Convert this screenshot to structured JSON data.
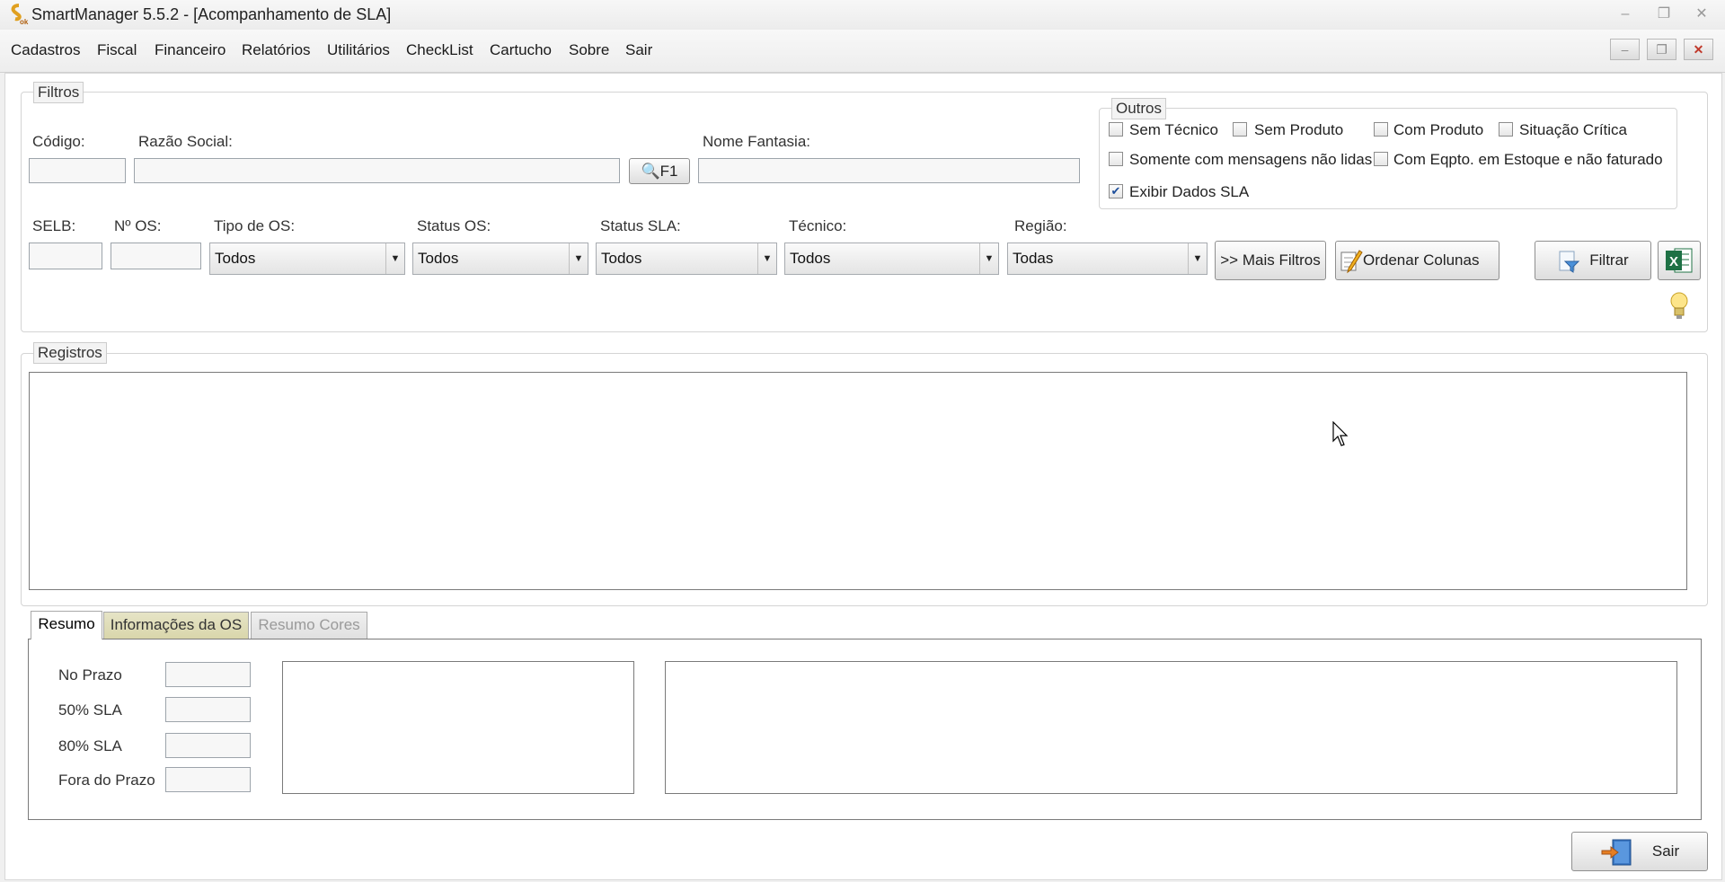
{
  "window": {
    "title": "SmartManager 5.5.2 - [Acompanhamento de SLA]"
  },
  "menu": [
    "Cadastros",
    "Fiscal",
    "Financeiro",
    "Relatórios",
    "Utilitários",
    "CheckList",
    "Cartucho",
    "Sobre",
    "Sair"
  ],
  "filtros": {
    "legend": "Filtros",
    "codigo_label": "Código:",
    "razao_label": "Razão Social:",
    "f1_label": "F1",
    "fantasia_label": "Nome Fantasia:",
    "selb_label": "SELB:",
    "nos_label": "Nº OS:",
    "tipo_os": {
      "label": "Tipo de OS:",
      "value": "Todos"
    },
    "status_os": {
      "label": "Status OS:",
      "value": "Todos"
    },
    "status_sla": {
      "label": "Status SLA:",
      "value": "Todos"
    },
    "tecnico": {
      "label": "Técnico:",
      "value": "Todos"
    },
    "regiao": {
      "label": "Região:",
      "value": "Todas"
    },
    "mais_filtros": ">> Mais Filtros",
    "ordenar_colunas": "Ordenar Colunas",
    "filtrar": "Filtrar"
  },
  "outros": {
    "legend": "Outros",
    "checkboxes": [
      {
        "label": "Sem Técnico",
        "checked": false
      },
      {
        "label": "Sem Produto",
        "checked": false
      },
      {
        "label": "Com Produto",
        "checked": false
      },
      {
        "label": "Situação Crítica",
        "checked": false
      },
      {
        "label": "Somente com mensagens não lidas",
        "checked": false
      },
      {
        "label": "Com Eqpto. em Estoque e não faturado",
        "checked": false
      },
      {
        "label": "Exibir Dados SLA",
        "checked": true
      }
    ]
  },
  "registros": {
    "legend": "Registros"
  },
  "tabs": [
    {
      "label": "Resumo",
      "state": "active"
    },
    {
      "label": "Informações da OS",
      "state": "normal"
    },
    {
      "label": "Resumo Cores",
      "state": "disabled"
    }
  ],
  "resumo": [
    "No Prazo",
    "50% SLA",
    "80% SLA",
    "Fora do Prazo"
  ],
  "footer": {
    "sair": "Sair"
  }
}
